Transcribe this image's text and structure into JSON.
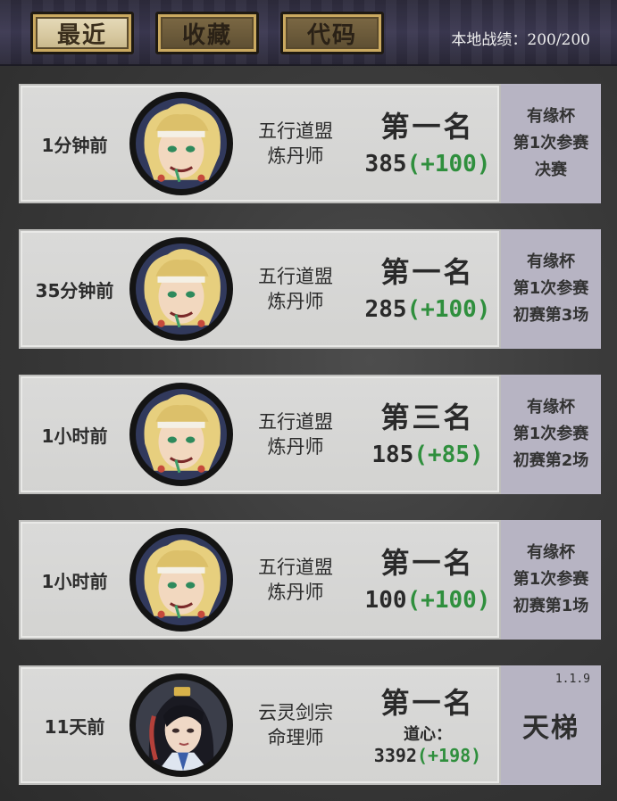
{
  "tabs": [
    {
      "label": "最近",
      "active": true
    },
    {
      "label": "收藏",
      "active": false
    },
    {
      "label": "代码",
      "active": false
    }
  ],
  "summary": {
    "label": "本地战绩：",
    "value": "200/200"
  },
  "records": [
    {
      "time": "1分钟前",
      "avatar": "blonde-hero-portrait",
      "sect": "五行道盟",
      "role": "炼丹师",
      "rank": "第一名",
      "score": "385",
      "delta": "(+100)",
      "event": [
        "有缘杯",
        "第1次参赛",
        "决赛"
      ]
    },
    {
      "time": "35分钟前",
      "avatar": "blonde-hero-portrait",
      "sect": "五行道盟",
      "role": "炼丹师",
      "rank": "第一名",
      "score": "285",
      "delta": "(+100)",
      "event": [
        "有缘杯",
        "第1次参赛",
        "初赛第3场"
      ]
    },
    {
      "time": "1小时前",
      "avatar": "blonde-hero-portrait",
      "sect": "五行道盟",
      "role": "炼丹师",
      "rank": "第三名",
      "score": "185",
      "delta": "(+85)",
      "event": [
        "有缘杯",
        "第1次参赛",
        "初赛第2场"
      ]
    },
    {
      "time": "1小时前",
      "avatar": "blonde-hero-portrait",
      "sect": "五行道盟",
      "role": "炼丹师",
      "rank": "第一名",
      "score": "100",
      "delta": "(+100)",
      "event": [
        "有缘杯",
        "第1次参赛",
        "初赛第1场"
      ]
    },
    {
      "time": "11天前",
      "avatar": "dark-haired-hero-portrait",
      "sect": "云灵剑宗",
      "role": "命理师",
      "rank": "第一名",
      "dao_label": "道心：",
      "score": "3392",
      "delta": "(+198)",
      "mode": "天梯",
      "version": "1.1.9"
    }
  ],
  "colors": {
    "delta_green": "#2f8f3d",
    "tab_gold": "#caa960",
    "side_panel": "#b7b4c3"
  }
}
